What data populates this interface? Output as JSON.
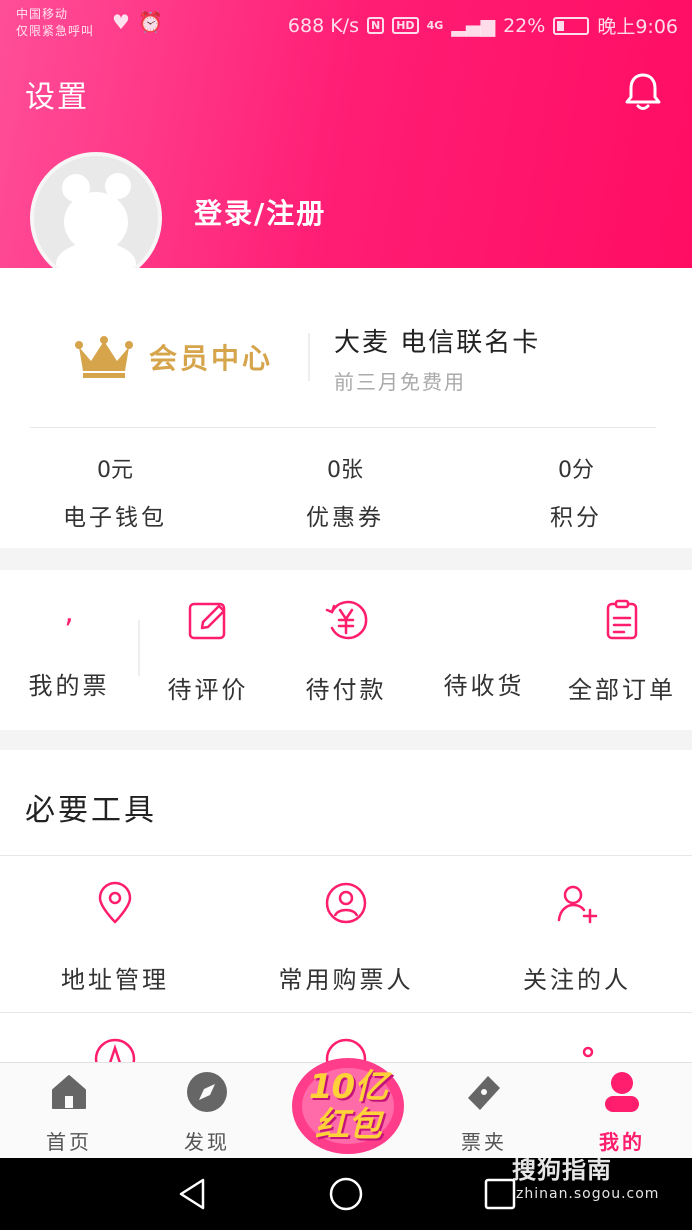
{
  "status_bar": {
    "carrier_line1": "中国移动",
    "carrier_line2": "仅限紧急呼叫",
    "left_icons": [
      "heart-pulse-icon",
      "alarm-icon"
    ],
    "speed": "688 K/s",
    "nfc": "N",
    "hd": "HD",
    "network": "4G",
    "battery": "22%",
    "time": "晚上9:06"
  },
  "header": {
    "title": "设置",
    "login_label": "登录/注册",
    "gradient_start": "#ff4e98",
    "gradient_end": "#ff0d63"
  },
  "membership": {
    "label": "会员中心",
    "promo_title": "大麦 电信联名卡",
    "promo_subtitle": "前三月免费用",
    "gold": "#d6a44a"
  },
  "stats": [
    {
      "value": "0元",
      "label": "电子钱包"
    },
    {
      "value": "0张",
      "label": "优惠券"
    },
    {
      "value": "0分",
      "label": "积分"
    }
  ],
  "orders": [
    {
      "label": "我的票",
      "icon": "ticket-icon"
    },
    {
      "label": "待评价",
      "icon": "edit-icon"
    },
    {
      "label": "待付款",
      "icon": "yuan-icon"
    },
    {
      "label": "待收货",
      "icon": "delivery-icon"
    },
    {
      "label": "全部订单",
      "icon": "clipboard-icon"
    }
  ],
  "tools": {
    "title": "必要工具",
    "items": [
      {
        "label": "地址管理",
        "icon": "location-pin-icon"
      },
      {
        "label": "常用购票人",
        "icon": "user-circle-icon"
      },
      {
        "label": "关注的人",
        "icon": "user-add-icon"
      }
    ]
  },
  "tabbar": {
    "items": [
      {
        "label": "首页",
        "icon": "home-icon"
      },
      {
        "label": "发现",
        "icon": "compass-icon"
      },
      {
        "label": "票夹",
        "icon": "ticket-folder-icon"
      },
      {
        "label": "我的",
        "icon": "profile-icon",
        "active": true
      }
    ],
    "promo_badge_line1": "10亿",
    "promo_badge_line2": "红包",
    "accent": "#ff1e6d"
  },
  "watermark": {
    "brand": "搜狗指南",
    "url": "zhinan.sogou.com"
  }
}
